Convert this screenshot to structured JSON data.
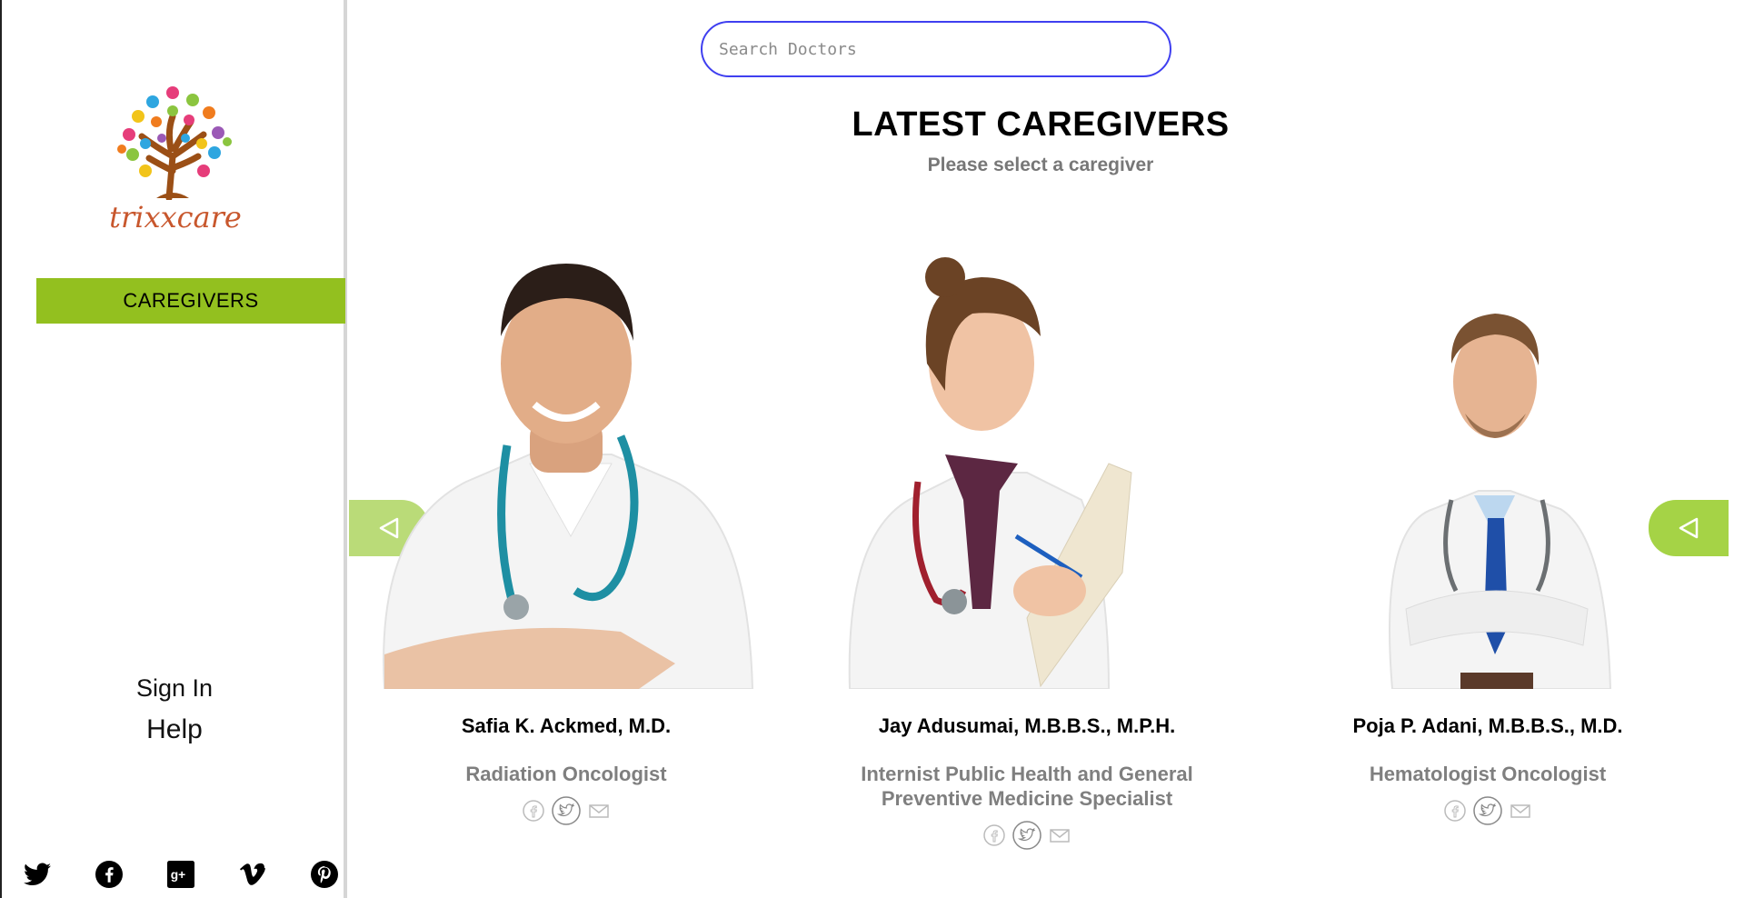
{
  "brand": {
    "name": "trixxcare"
  },
  "nav": {
    "active_label": "CAREGIVERS",
    "sign_in": "Sign In",
    "help": "Help"
  },
  "social": [
    "twitter-icon",
    "facebook-icon",
    "google-plus-icon",
    "vimeo-icon",
    "pinterest-icon"
  ],
  "search": {
    "placeholder": "Search Doctors",
    "value": ""
  },
  "section": {
    "title": "LATEST CAREGIVERS",
    "subtitle": "Please select a caregiver"
  },
  "caregivers": [
    {
      "name": "Safia K. Ackmed, M.D.",
      "specialty": "Radiation Oncologist"
    },
    {
      "name": "Jay Adusumai, M.B.B.S., M.P.H.",
      "specialty": "Internist Public Health and General Preventive Medicine Specialist"
    },
    {
      "name": "Poja P. Adani, M.B.B.S., M.D.",
      "specialty": "Hematologist Oncologist"
    }
  ],
  "colors": {
    "accent": "#93c01f",
    "search_border": "#3f3ff0",
    "logo_text": "#c8572d"
  }
}
